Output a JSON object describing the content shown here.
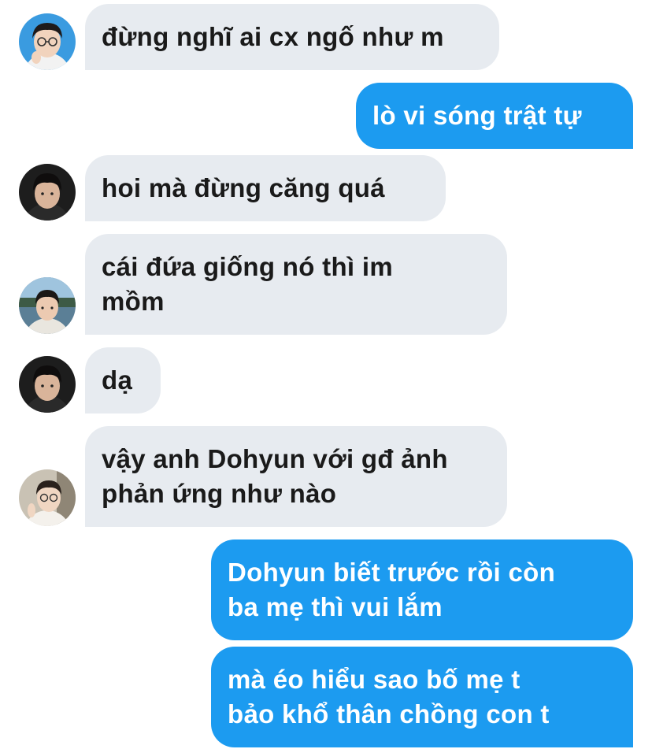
{
  "conversation": {
    "messages": [
      {
        "sender": "them",
        "avatar": "boy-glasses",
        "text": "đừng nghĩ ai cx ngố như m"
      },
      {
        "sender": "me",
        "text": "lò vi sóng trật tự"
      },
      {
        "sender": "them",
        "avatar": "boy-dark",
        "text": "hoi mà đừng căng quá"
      },
      {
        "sender": "them",
        "avatar": "boy-outdoor",
        "text": "cái đứa giống nó thì im\nmồm"
      },
      {
        "sender": "them",
        "avatar": "boy-dark",
        "text": "dạ"
      },
      {
        "sender": "them",
        "avatar": "boy-glasses-peace",
        "text": "vậy anh Dohyun với gđ ảnh\nphản ứng như nào"
      },
      {
        "sender": "me",
        "text": "Dohyun biết trước rồi còn\nba mẹ thì vui lắm"
      },
      {
        "sender": "me",
        "text": "mà éo hiểu sao bố mẹ t\nbảo khổ thân chồng con t"
      }
    ]
  },
  "colors": {
    "incoming_bubble": "#e7ebf0",
    "outgoing_bubble": "#1c9bf0",
    "incoming_text": "#1a1a1a",
    "outgoing_text": "#ffffff"
  }
}
